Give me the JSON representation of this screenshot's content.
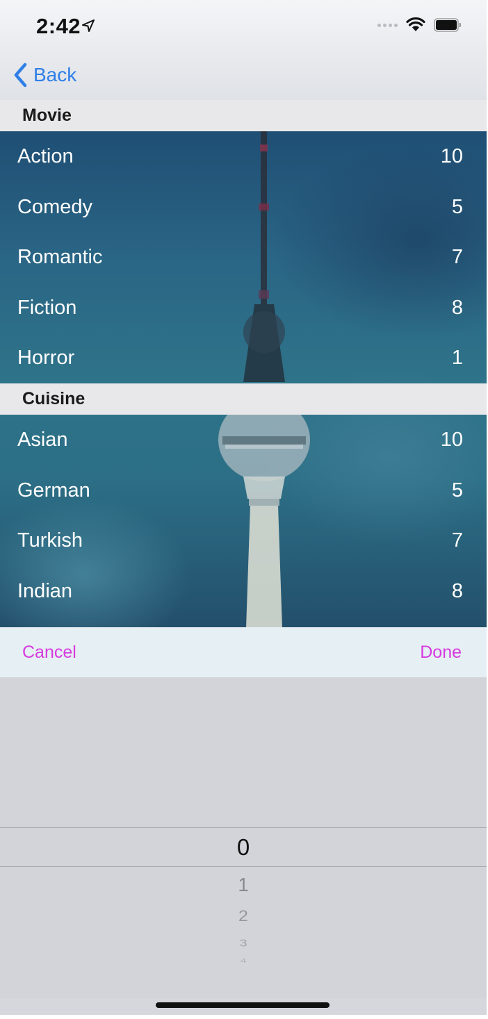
{
  "status_bar": {
    "time": "2:42",
    "location_icon": "location-arrow-icon",
    "wifi_icon": "wifi-icon",
    "battery_icon": "battery-icon"
  },
  "nav": {
    "back_label": "Back",
    "back_icon": "chevron-left-icon",
    "accent_color": "#2f7fe8"
  },
  "sections": [
    {
      "header": "Movie",
      "rows": [
        {
          "label": "Action",
          "value": "10"
        },
        {
          "label": "Comedy",
          "value": "5"
        },
        {
          "label": "Romantic",
          "value": "7"
        },
        {
          "label": "Fiction",
          "value": "8"
        },
        {
          "label": "Horror",
          "value": "1"
        }
      ]
    },
    {
      "header": "Cuisine",
      "rows": [
        {
          "label": "Asian",
          "value": "10"
        },
        {
          "label": "German",
          "value": "5"
        },
        {
          "label": "Turkish",
          "value": "7"
        },
        {
          "label": "Indian",
          "value": "8"
        }
      ]
    }
  ],
  "toolbar": {
    "cancel_label": "Cancel",
    "done_label": "Done",
    "color": "#d63be0"
  },
  "picker": {
    "items": [
      "0",
      "1",
      "2",
      "3",
      "4"
    ],
    "selected": "0"
  }
}
